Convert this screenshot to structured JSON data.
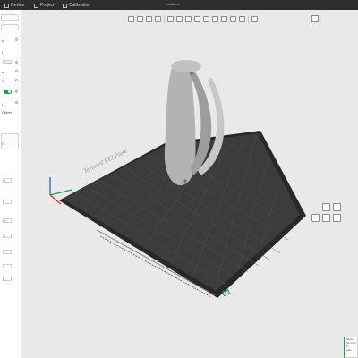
{
  "app": {
    "title": "Untitled"
  },
  "tabs": [
    {
      "label": "Device",
      "icon": "device-icon"
    },
    {
      "label": "Project",
      "icon": "project-icon"
    },
    {
      "label": "Calibration",
      "icon": "calibration-icon"
    }
  ],
  "sidebar": {
    "labels": [
      "s",
      "l",
      "a",
      "S",
      "I",
      "C"
    ],
    "fields": [
      "Mysta",
      "S",
      "I",
      "W",
      "E"
    ],
    "button": "Offlnes"
  },
  "plate": {
    "name": "Textured PEI Plate",
    "number": "01",
    "colors": {
      "bed": "#3a3a3a",
      "frame": "#262626",
      "grid": "#4f4f4f",
      "model": "#b3b3b3",
      "accent": "#1e9e4a"
    }
  },
  "notification": {
    "lines": [
      "Slicing",
      "No error",
      "P...",
      "ealo",
      "e..."
    ]
  }
}
